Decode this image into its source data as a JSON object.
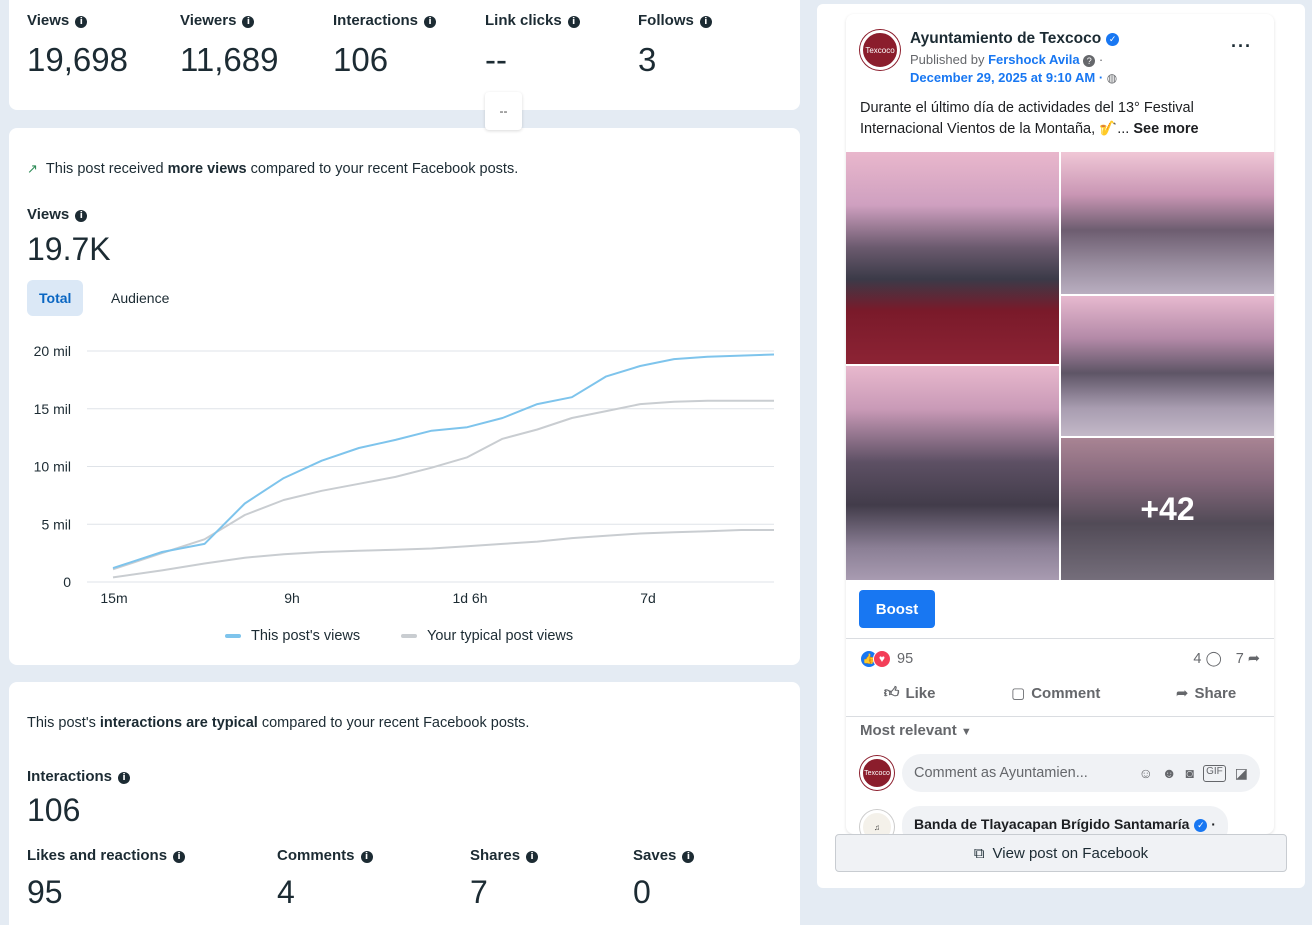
{
  "top_stats": [
    {
      "label": "Views",
      "value": "19,698"
    },
    {
      "label": "Viewers",
      "value": "11,689"
    },
    {
      "label": "Interactions",
      "value": "106"
    },
    {
      "label": "Link clicks",
      "value": "--"
    },
    {
      "label": "Follows",
      "value": "3"
    }
  ],
  "toggle_tab": "--",
  "views_card": {
    "insight_pre": "This post received ",
    "insight_bold": "more views",
    "insight_post": " compared to your recent Facebook posts.",
    "label": "Views",
    "value": "19.7K",
    "tabs": [
      "Total",
      "Audience"
    ],
    "legend": [
      "This post's views",
      "Your typical post views"
    ]
  },
  "chart_data": {
    "type": "line",
    "x_ticks": [
      "15m",
      "9h",
      "1d 6h",
      "7d"
    ],
    "y_ticks": [
      "0",
      "5 mil",
      "10 mil",
      "15 mil",
      "20 mil"
    ],
    "ylim": [
      0,
      20000
    ],
    "grid": true,
    "legend_position": "bottom",
    "series": [
      {
        "name": "This post's views",
        "color": "#7ec4ec",
        "values": [
          1200,
          2600,
          3300,
          6800,
          9000,
          10500,
          11600,
          12300,
          13100,
          13400,
          14200,
          15400,
          16000,
          17800,
          18700,
          19300,
          19500,
          19600,
          19700
        ]
      },
      {
        "name": "Your typical post views",
        "color": "#c9cdd1",
        "values": [
          1100,
          2500,
          3700,
          5800,
          7100,
          7900,
          8500,
          9100,
          9900,
          10800,
          12400,
          13200,
          14200,
          14800,
          15400,
          15600,
          15700,
          15700,
          15700
        ]
      },
      {
        "name": "",
        "color": "#c9cdd1",
        "values": [
          400,
          1000,
          1600,
          2100,
          2400,
          2600,
          2700,
          2800,
          2900,
          3100,
          3300,
          3500,
          3800,
          4000,
          4200,
          4300,
          4400,
          4500,
          4500
        ]
      }
    ]
  },
  "interactions_card": {
    "insight_pre": "This post's ",
    "insight_bold": "interactions are typical",
    "insight_post": " compared to your recent Facebook posts.",
    "label": "Interactions",
    "value": "106",
    "sub": [
      {
        "label": "Likes and reactions",
        "value": "95"
      },
      {
        "label": "Comments",
        "value": "4"
      },
      {
        "label": "Shares",
        "value": "7"
      },
      {
        "label": "Saves",
        "value": "0"
      }
    ]
  },
  "post": {
    "avatar_text": "Texcoco",
    "page_name": "Ayuntamiento de Texcoco",
    "published_by": "Published by",
    "author": "Fershock Avila",
    "date": "December 29, 2025 at 9:10 AM",
    "text": "Durante el último día de actividades del 13° Festival Internacional Vientos de la Montaña, 🎷...",
    "see_more": "See more",
    "more_photos": "+42",
    "boost": "Boost",
    "reactions_count": "95",
    "comments_count": "4",
    "shares_count": "7",
    "actions": [
      "Like",
      "Comment",
      "Share"
    ],
    "most_relevant": "Most relevant",
    "comment_placeholder": "Comment as Ayuntamien...",
    "commenter": "Banda de Tlayacapan Brígido Santamaría",
    "view_on_fb": "View post on Facebook"
  },
  "colors": {
    "accent": "#1877f2",
    "post_line": "#7ec4ec",
    "typical_line": "#c9cdd1",
    "brand": "#8b1d2c"
  }
}
